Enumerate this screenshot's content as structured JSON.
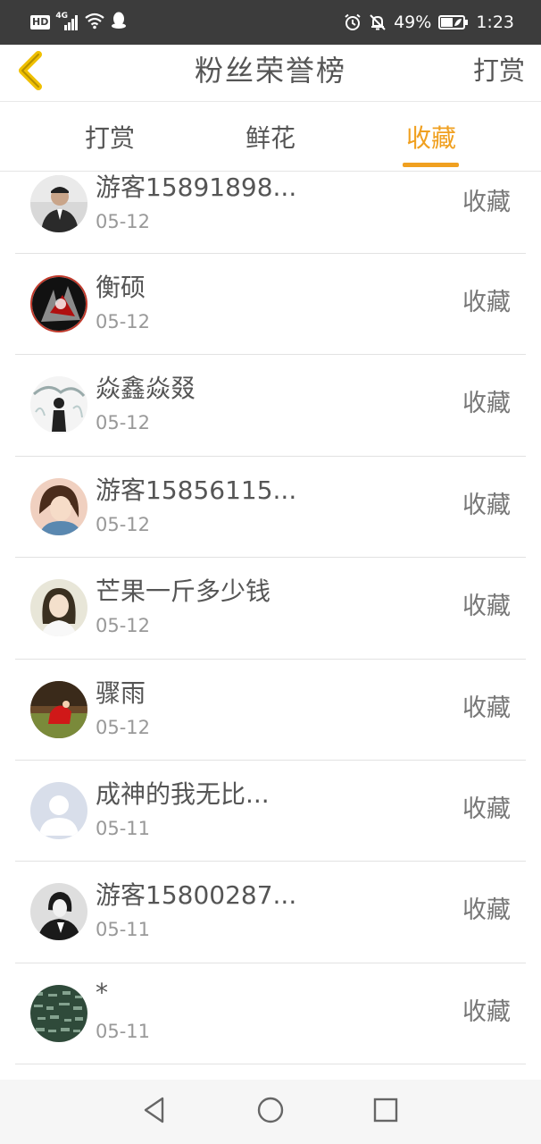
{
  "status_bar": {
    "hd": "HD",
    "network": "4G",
    "battery": "49%",
    "time": "1:23"
  },
  "header": {
    "title": "粉丝荣誉榜",
    "action": "打赏"
  },
  "tabs": [
    {
      "label": "打赏",
      "active": false
    },
    {
      "label": "鲜花",
      "active": false
    },
    {
      "label": "收藏",
      "active": true
    }
  ],
  "accent_color": "#f0a020",
  "fans": [
    {
      "name": "游客15891898...",
      "date": "05-12",
      "action": "收藏"
    },
    {
      "name": "衡硕",
      "date": "05-12",
      "action": "收藏"
    },
    {
      "name": "焱鑫焱叕",
      "date": "05-12",
      "action": "收藏"
    },
    {
      "name": "游客15856115...",
      "date": "05-12",
      "action": "收藏"
    },
    {
      "name": "芒果一斤多少钱",
      "date": "05-12",
      "action": "收藏"
    },
    {
      "name": "骤雨",
      "date": "05-12",
      "action": "收藏"
    },
    {
      "name": "成神的我无比...",
      "date": "05-11",
      "action": "收藏"
    },
    {
      "name": "游客15800287...",
      "date": "05-11",
      "action": "收藏"
    },
    {
      "name": "*",
      "date": "05-11",
      "action": "收藏"
    }
  ],
  "nav": {
    "back_icon": "triangle-back-icon",
    "home_icon": "circle-home-icon",
    "recents_icon": "square-recents-icon"
  }
}
